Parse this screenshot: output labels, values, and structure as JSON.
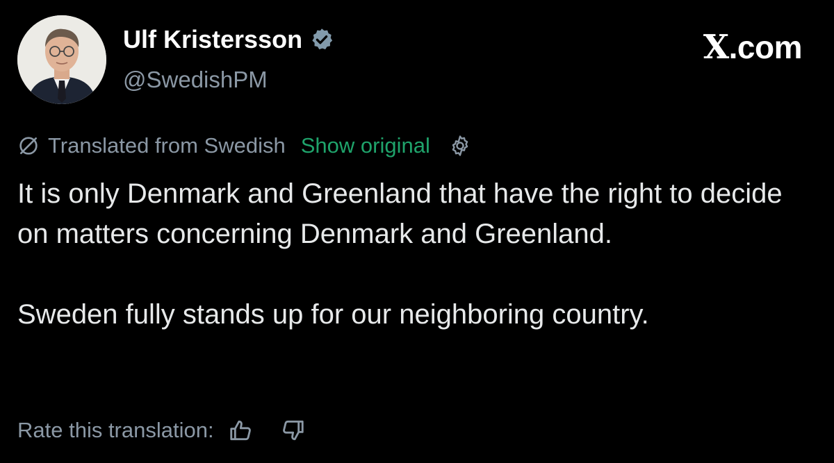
{
  "author": {
    "display_name": "Ulf Kristersson",
    "handle": "@SwedishPM",
    "verified_icon": "verified-badge-icon"
  },
  "brand": {
    "x_glyph": "X",
    "suffix": ".com"
  },
  "translation": {
    "label": "Translated from Swedish",
    "show_original": "Show original",
    "icon": "translate-off-icon",
    "settings_icon": "gear-icon"
  },
  "post": {
    "paragraphs": [
      "It is only Denmark and Greenland that have the right to decide on matters concerning Denmark and Greenland.",
      "Sweden fully stands up for our neighboring country."
    ]
  },
  "rating": {
    "label": "Rate this translation:",
    "up_icon": "thumbs-up-icon",
    "down_icon": "thumbs-down-icon"
  },
  "colors": {
    "background": "#000000",
    "text": "#e7e9ea",
    "muted": "#8b98a5",
    "link_green": "#1fa36b",
    "verified": "#829aab"
  }
}
